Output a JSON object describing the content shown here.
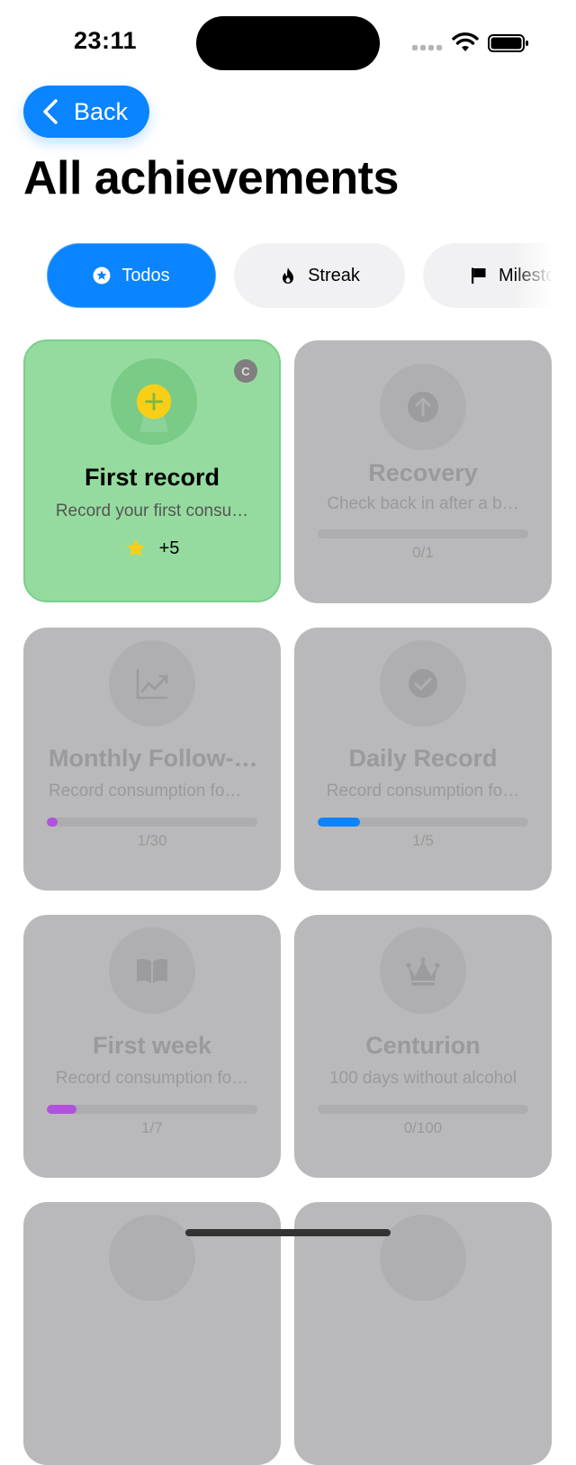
{
  "status": {
    "time": "23:11"
  },
  "nav": {
    "back_label": "Back"
  },
  "page": {
    "title": "All achievements"
  },
  "tabs": [
    {
      "label": "Todos",
      "icon": "star-circle-icon",
      "active": true
    },
    {
      "label": "Streak",
      "icon": "flame-icon",
      "active": false
    },
    {
      "label": "Milestones",
      "icon": "flag-icon",
      "active": false
    }
  ],
  "achievements": [
    {
      "name": "First record",
      "description": "Record your first consu…",
      "badge": "C",
      "reward": "+5",
      "icon": "plus-medal-icon",
      "unlocked": true
    },
    {
      "name": "Recovery",
      "description": "Check back in after a b…",
      "progress": "0/1",
      "progress_value": 0,
      "progress_max": 1,
      "icon": "arrow-up-icon",
      "unlocked": false
    },
    {
      "name": "Monthly Follow-…",
      "description": "Record consumption fo…",
      "progress": "1/30",
      "progress_value": 1,
      "progress_max": 30,
      "bar_color": "#af52de",
      "icon": "chart-trend-icon",
      "unlocked": false
    },
    {
      "name": "Daily Record",
      "description": "Record consumption fo…",
      "progress": "1/5",
      "progress_value": 1,
      "progress_max": 5,
      "bar_color": "#0a84ff",
      "icon": "check-circle-icon",
      "unlocked": false
    },
    {
      "name": "First week",
      "description": "Record consumption fo…",
      "progress": "1/7",
      "progress_value": 1,
      "progress_max": 7,
      "bar_color": "#af52de",
      "icon": "book-icon",
      "unlocked": false
    },
    {
      "name": "Centurion",
      "description": "100 days without alcohol",
      "progress": "0/100",
      "progress_value": 0,
      "progress_max": 100,
      "icon": "crown-icon",
      "unlocked": false
    }
  ],
  "colors": {
    "accent": "#0a84ff",
    "unlocked_card": "#95db9f",
    "locked_card": "#b9b9bb"
  }
}
